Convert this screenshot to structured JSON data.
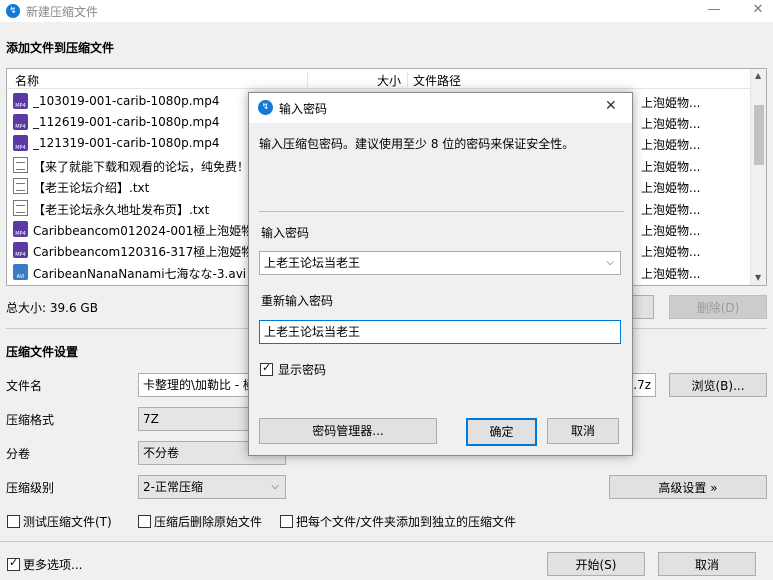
{
  "window": {
    "title": "新建压缩文件",
    "minimize": "—",
    "close": "✕"
  },
  "add_section": {
    "title": "添加文件到压缩文件",
    "columns": {
      "name": "名称",
      "size": "大小",
      "path": "文件路径"
    },
    "files": [
      {
        "icon": "mp4",
        "name": "_103019-001-carib-1080p.mp4",
        "path": "上泡姫物..."
      },
      {
        "icon": "mp4",
        "name": "_112619-001-carib-1080p.mp4",
        "path": "上泡姫物..."
      },
      {
        "icon": "mp4",
        "name": "_121319-001-carib-1080p.mp4",
        "path": "上泡姫物..."
      },
      {
        "icon": "txt",
        "name": "【来了就能下载和观看的论坛，纯免费！】",
        "path": "上泡姫物..."
      },
      {
        "icon": "txt",
        "name": "【老王论坛介绍】.txt",
        "path": "上泡姫物..."
      },
      {
        "icon": "txt",
        "name": "【老王论坛永久地址发布页】.txt",
        "path": "上泡姫物..."
      },
      {
        "icon": "mp4",
        "name": "Caribbeancom012024-001極上泡姫物語",
        "path": "上泡姫物..."
      },
      {
        "icon": "mp4",
        "name": "Caribbeancom120316-317極上泡姫物語",
        "path": "上泡姫物..."
      },
      {
        "icon": "avi",
        "name": "CaribeanNanaNanami七海なな-3.avi",
        "path": "上泡姫物..."
      }
    ],
    "total_size": "总大小: 39.6 GB",
    "delete_button": "删除(D)"
  },
  "settings": {
    "title": "压缩文件设置",
    "filename_label": "文件名",
    "filename_value": "卡整理的\\加勒比 - 極",
    "filename_suffix": ".7z",
    "browse_button": "浏览(B)...",
    "format_label": "压缩格式",
    "format_value": "7Z",
    "split_label": "分卷",
    "split_value": "不分卷",
    "level_label": "压缩级别",
    "level_value": "2-正常压缩",
    "advanced_button": "高级设置 »",
    "opt_test": "测试压缩文件(T)",
    "opt_delete": "压缩后删除原始文件",
    "opt_separate": "把每个文件/文件夹添加到独立的压缩文件"
  },
  "footer": {
    "more_options": "更多选项...",
    "start_button": "开始(S)",
    "cancel_button": "取消"
  },
  "password_dialog": {
    "title": "输入密码",
    "close": "✕",
    "description": "输入压缩包密码。建议使用至少 8 位的密码来保证安全性。",
    "enter_label": "输入密码",
    "enter_value": "上老王论坛当老王",
    "reenter_label": "重新输入密码",
    "reenter_value": "上老王论坛当老王",
    "show_password": "显示密码",
    "manager_button": "密码管理器...",
    "ok_button": "确定",
    "cancel_button": "取消"
  },
  "colors": {
    "accent": "#0078d7",
    "icon_mp4": "#5b3aa8",
    "icon_avi": "#3a7ac9"
  }
}
